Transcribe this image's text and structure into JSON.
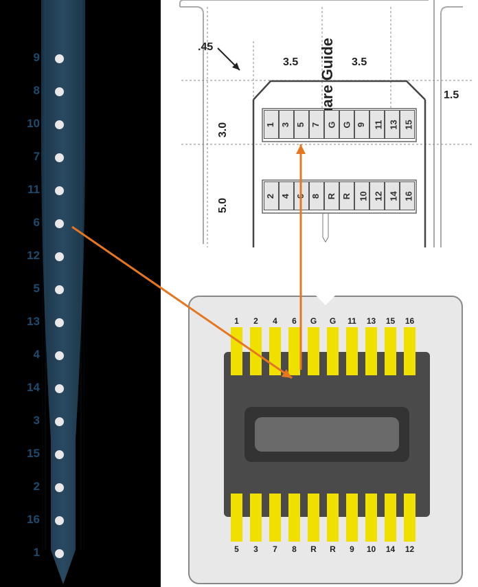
{
  "probe": {
    "electrodes": [
      {
        "num": "9"
      },
      {
        "num": "8"
      },
      {
        "num": "10"
      },
      {
        "num": "7"
      },
      {
        "num": "11"
      },
      {
        "num": "6"
      },
      {
        "num": "12"
      },
      {
        "num": "5"
      },
      {
        "num": "13"
      },
      {
        "num": "4"
      },
      {
        "num": "14"
      },
      {
        "num": "3"
      },
      {
        "num": "15"
      },
      {
        "num": "2"
      },
      {
        "num": "16"
      },
      {
        "num": "1"
      }
    ]
  },
  "schematic": {
    "side_label": "Square Guide",
    "dim_45": ".45",
    "dim_35a": "3.5",
    "dim_35b": "3.5",
    "dim_15": "1.5",
    "dim_30": "3.0",
    "dim_50": "5.0",
    "top_row": [
      "1",
      "3",
      "5",
      "7",
      "G",
      "G",
      "9",
      "11",
      "13",
      "15"
    ],
    "bot_row": [
      "2",
      "4",
      "6",
      "8",
      "R",
      "R",
      "10",
      "12",
      "14",
      "16"
    ]
  },
  "connector": {
    "top_labels": [
      "1",
      "2",
      "4",
      "6",
      "G",
      "G",
      "11",
      "13",
      "15",
      "16"
    ],
    "bot_labels": [
      "5",
      "3",
      "7",
      "8",
      "R",
      "R",
      "9",
      "10",
      "14",
      "12"
    ]
  }
}
